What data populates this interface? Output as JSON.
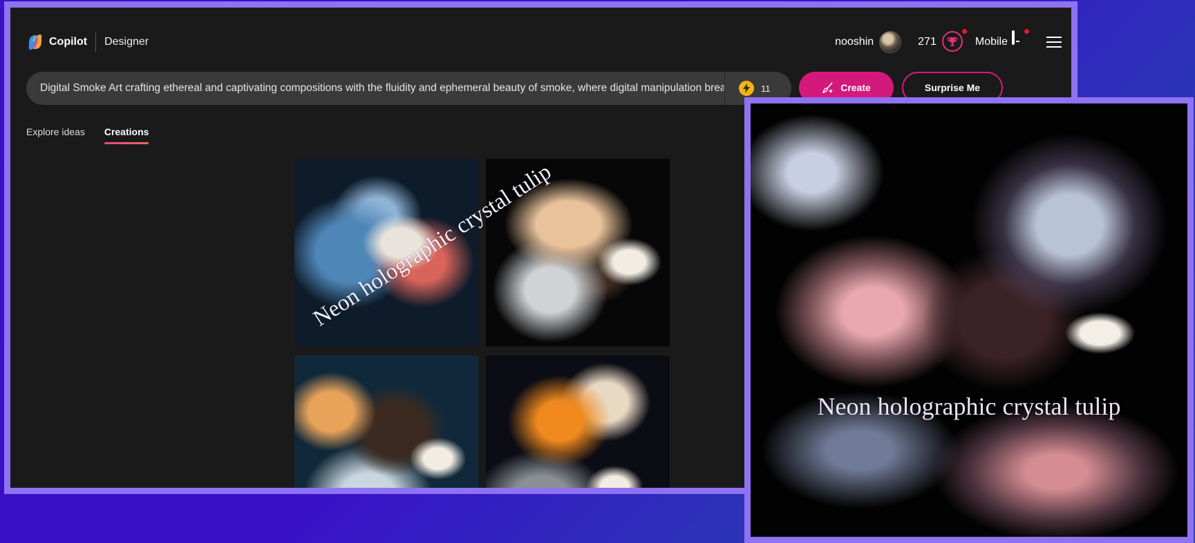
{
  "header": {
    "brand": "Copilot",
    "product": "Designer",
    "username": "nooshin",
    "points": "271",
    "mobile_label": "Mobile"
  },
  "prompt": {
    "value": "Digital Smoke Art crafting ethereal and captivating compositions with the fluidity and ephemeral beauty of smoke, where digital manipulation breathes lif",
    "boosts": "11"
  },
  "actions": {
    "create_label": "Create",
    "surprise_label": "Surprise Me"
  },
  "tabs": [
    {
      "label": "Explore ideas",
      "active": false
    },
    {
      "label": "Creations",
      "active": true
    }
  ],
  "overlay": {
    "watermark_text": "Neon holographic crystal tulip"
  },
  "colors": {
    "accent": "#d4197c",
    "frame": "#8f72f2",
    "app_bg": "#1b1a1a",
    "boost": "#f2b414"
  }
}
